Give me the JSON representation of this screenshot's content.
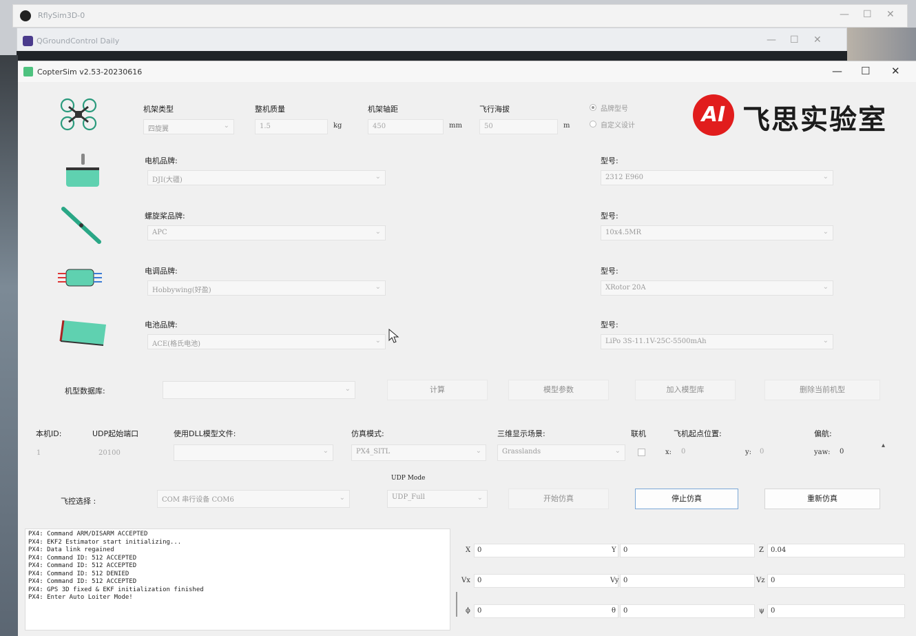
{
  "outer_window": {
    "title": "RflySim3D-0"
  },
  "qgc_window": {
    "title": "QGroundControl Daily"
  },
  "window": {
    "title": "CopterSim v2.53-20230616"
  },
  "airframe": {
    "type_label": "机架类型",
    "type_value": "四旋翼",
    "mass_label": "整机质量",
    "mass_value": "1.5",
    "mass_unit": "kg",
    "wheelbase_label": "机架轴距",
    "wheelbase_value": "450",
    "wheelbase_unit": "mm",
    "altitude_label": "飞行海拔",
    "altitude_value": "50",
    "altitude_unit": "m",
    "radio_brand": "品牌型号",
    "radio_custom": "自定义设计"
  },
  "logo": {
    "mark": "AI",
    "text": "飞思实验室"
  },
  "components": [
    {
      "brand_label": "电机品牌:",
      "brand_value": "DJI(大疆)",
      "model_label": "型号:",
      "model_value": "2312 E960"
    },
    {
      "brand_label": "螺旋桨品牌:",
      "brand_value": "APC",
      "model_label": "型号:",
      "model_value": "10x4.5MR"
    },
    {
      "brand_label": "电调品牌:",
      "brand_value": "Hobbywing(好盈)",
      "model_label": "型号:",
      "model_value": "XRotor 20A"
    },
    {
      "brand_label": "电池品牌:",
      "brand_value": "ACE(格氏电池)",
      "model_label": "型号:",
      "model_value": "LiPo 3S-11.1V-25C-5500mAh"
    }
  ],
  "database": {
    "label": "机型数据库:",
    "calc_button": "计算",
    "params_button": "模型参数",
    "add_button": "加入模型库",
    "delete_button": "删除当前机型"
  },
  "sim": {
    "id_label": "本机ID:",
    "id_value": "1",
    "udp_label": "UDP起始端口",
    "udp_value": "20100",
    "dll_label": "使用DLL模型文件:",
    "dll_value": "",
    "mode_label": "仿真模式:",
    "mode_value": "PX4_SITL",
    "scene_label": "三维显示场景:",
    "scene_value": "Grasslands",
    "network_label": "联机",
    "origin_label": "飞机起点位置:",
    "x_label": "x:",
    "x_value": "0",
    "y_label": "y:",
    "y_value": "0",
    "yaw_section_label": "偏航:",
    "yaw_label": "yaw:",
    "yaw_value": "0",
    "fc_label": "飞控选择 :",
    "fc_value": "COM 串行设备 COM6",
    "udp_mode_label": "UDP Mode",
    "udp_mode_value": "UDP_Full",
    "start_button": "开始仿真",
    "stop_button": "停止仿真",
    "restart_button": "重新仿真"
  },
  "console_lines": [
    "PX4: Command ARM/DISARM ACCEPTED",
    "PX4: EKF2 Estimator start initializing...",
    "PX4: Data link regained",
    "PX4: Command ID: 512 ACCEPTED",
    "PX4: Command ID: 512 ACCEPTED",
    "PX4: Command ID: 512 DENIED",
    "PX4: Command ID: 512 ACCEPTED",
    "PX4: GPS 3D fixed & EKF initialization finished",
    "PX4: Enter Auto Loiter Mode!"
  ],
  "state": {
    "x_label": "X",
    "x_value": "0",
    "y_label": "Y",
    "y_value": "0",
    "z_label": "Z",
    "z_value": "0.04",
    "vx_label": "Vx",
    "vx_value": "0",
    "vy_label": "Vy",
    "vy_value": "0",
    "vz_label": "Vz",
    "vz_value": "0",
    "roll_label": "ϕ",
    "roll_value": "0",
    "pitch_label": "θ",
    "pitch_value": "0",
    "yaw_label": "ψ",
    "yaw_value": "0"
  },
  "colors": {
    "accent_mint": "#5fd1b0",
    "logo_red": "#e11d1d",
    "active_border": "#7aa7d6"
  }
}
